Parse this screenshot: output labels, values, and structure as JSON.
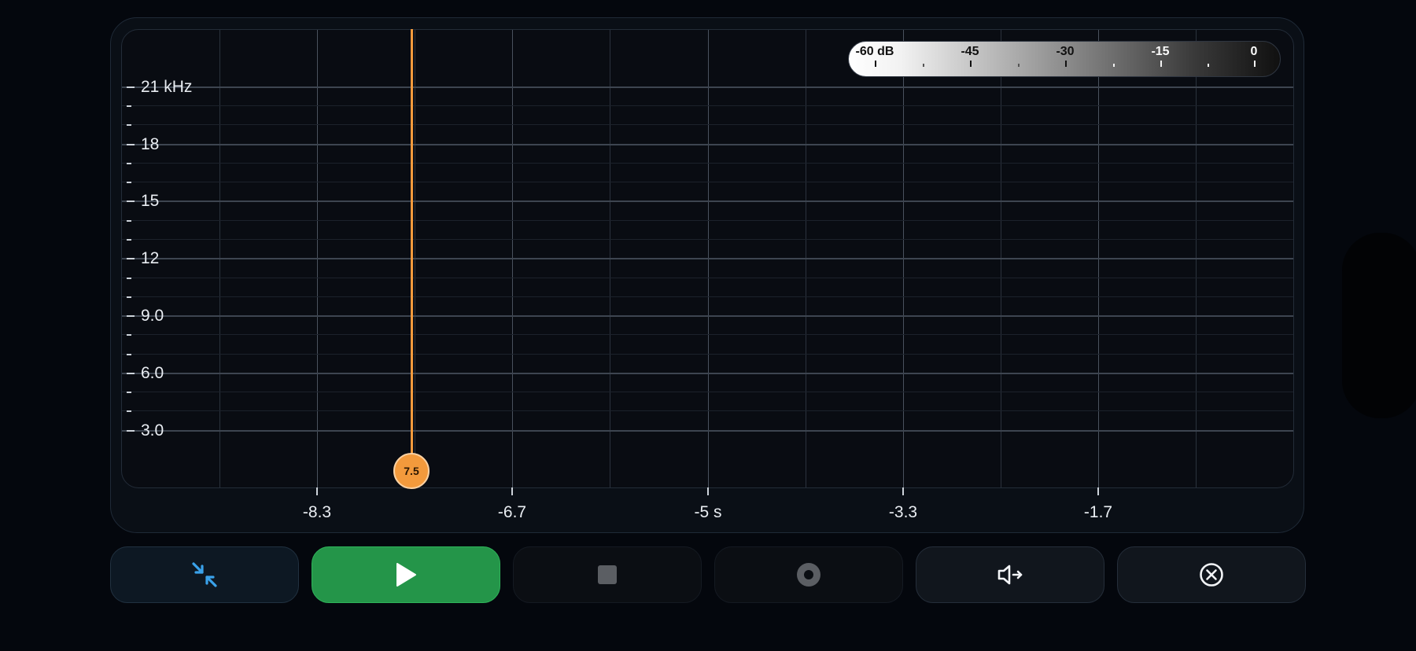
{
  "spectrogram": {
    "y_unit_label": "21 kHz",
    "y_labels": [
      "18",
      "15",
      "12",
      "9.0",
      "6.0",
      "3.0"
    ],
    "x_labels": [
      "-8.3",
      "-6.7",
      "-5 s",
      "-3.3",
      "-1.7"
    ],
    "playhead_value": "7.5",
    "playhead_color": "#f39a3c"
  },
  "db_scale": {
    "labels": [
      "-60 dB",
      "-45",
      "-30",
      "-15",
      "0"
    ]
  },
  "controls": {
    "collapse_icon": "collapse-arrows-icon",
    "play_icon": "play-icon",
    "stop_icon": "stop-icon",
    "record_icon": "record-icon",
    "route_icon": "speaker-route-icon",
    "close_icon": "close-circle-icon",
    "accent_play": "#249549",
    "accent_collapse": "#3aa2ea"
  }
}
